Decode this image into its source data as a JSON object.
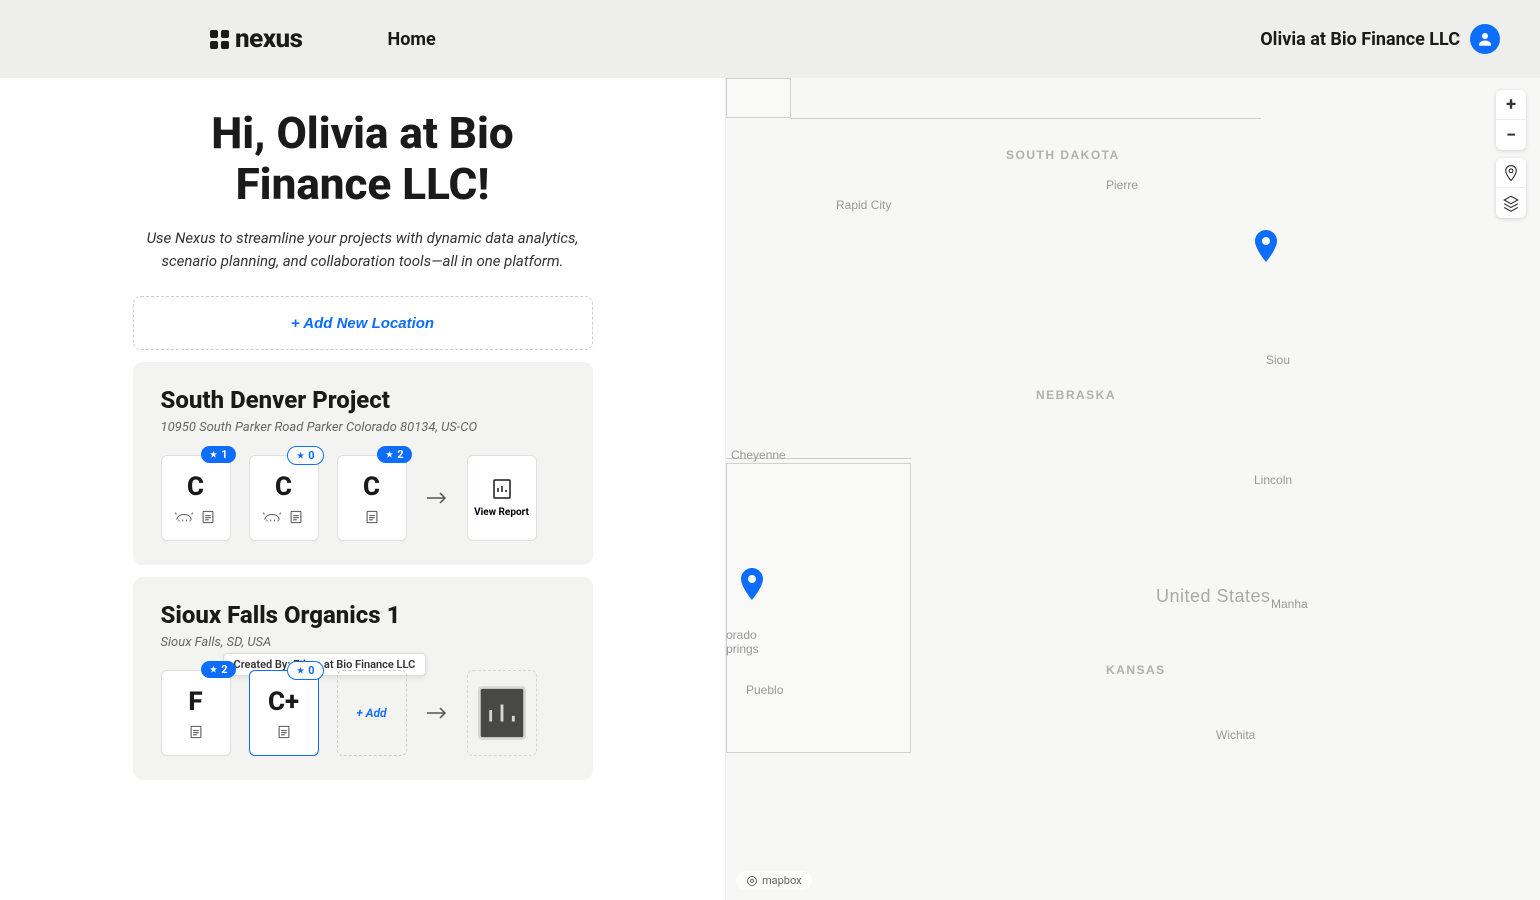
{
  "header": {
    "brand": "nexus",
    "nav_home": "Home",
    "user_label": "Olivia at Bio Finance LLC"
  },
  "greeting": "Hi, Olivia at Bio Finance LLC!",
  "subtitle": "Use Nexus to streamline your projects with dynamic data analytics, scenario planning, and collaboration tools—all in one platform.",
  "add_location_label": "+ Add New Location",
  "projects": [
    {
      "title": "South Denver Project",
      "address": "10950 South Parker Road Parker Colorado 80134, US-CO",
      "cards": [
        {
          "stars": "1",
          "grade": "C",
          "icons": [
            "cow",
            "report"
          ],
          "badge_style": "filled"
        },
        {
          "stars": "0",
          "grade": "C",
          "icons": [
            "cow",
            "report"
          ],
          "badge_style": "outline"
        },
        {
          "stars": "2",
          "grade": "C",
          "icons": [
            "report"
          ],
          "badge_style": "filled"
        }
      ],
      "view_report": "View Report"
    },
    {
      "title": "Sioux Falls Organics 1",
      "address": "Sioux Falls, SD, USA",
      "tooltip": "Created By: Ethan at Bio Finance LLC",
      "cards": [
        {
          "stars": "2",
          "grade": "F",
          "icons": [
            "report"
          ],
          "badge_style": "filled"
        },
        {
          "stars": "0",
          "grade": "C+",
          "icons": [
            "report"
          ],
          "badge_style": "outline",
          "highlighted": true
        }
      ],
      "add_label": "+ Add"
    }
  ],
  "map": {
    "attribution": "mapbox",
    "labels": {
      "south_dakota": "SOUTH DAKOTA",
      "nebraska": "NEBRASKA",
      "kansas": "KANSAS",
      "united_states": "United States",
      "rapid_city": "Rapid City",
      "pierre": "Pierre",
      "cheyenne": "Cheyenne",
      "orado_springs": "orado\nprings",
      "pueblo": "Pueblo",
      "lincoln": "Lincoln",
      "wichita": "Wichita",
      "manha": "Manha",
      "siou": "Siou"
    }
  },
  "colors": {
    "accent": "#0d6efd",
    "bg_header": "#eeeeec",
    "card_bg": "#f3f3f1"
  }
}
